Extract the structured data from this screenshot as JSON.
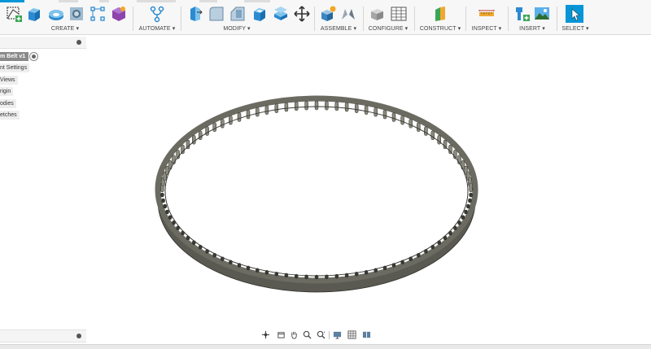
{
  "toolbar": {
    "groups": [
      {
        "label": "CREATE ▾"
      },
      {
        "label": "AUTOMATE ▾"
      },
      {
        "label": "MODIFY ▾"
      },
      {
        "label": "ASSEMBLE ▾"
      },
      {
        "label": "CONFIGURE ▾"
      },
      {
        "label": "CONSTRUCT ▾"
      },
      {
        "label": "INSPECT ▾"
      },
      {
        "label": "INSERT ▾"
      },
      {
        "label": "SELECT ▾"
      }
    ]
  },
  "browser": {
    "items": [
      {
        "label": "m Belt v1"
      },
      {
        "label": "nt Settings"
      },
      {
        "label": " Views"
      },
      {
        "label": "rigin"
      },
      {
        "label": "odies"
      },
      {
        "label": "etches"
      }
    ]
  },
  "colors": {
    "accent": "#0696d7",
    "belt_outer": "#5a5a52",
    "belt_dark": "#3a3a35"
  },
  "icons": {
    "browser_settings": "dot-icon",
    "comments_settings": "dot-icon",
    "nav": [
      "orbit-icon",
      "pan-hand-icon",
      "look-at-icon",
      "zoom-icon",
      "zoom-window-icon",
      "display-settings-icon",
      "grid-settings-icon",
      "viewports-icon"
    ]
  }
}
